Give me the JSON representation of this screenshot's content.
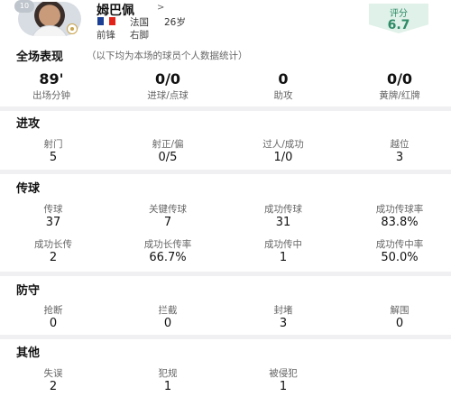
{
  "player": {
    "number_badge": "10",
    "name": "姆巴佩",
    "name_arrow": ">",
    "country": "法国",
    "age": "26岁",
    "position": "前锋",
    "foot": "右脚",
    "flag_colors": [
      "#1b3f95",
      "#ffffff",
      "#e2231a"
    ],
    "rating_label": "评分",
    "rating_value": "6.7",
    "rating_color": "#2e8a67"
  },
  "overview": {
    "title": "全场表现",
    "note": "（以下均为本场的球员个人数据统计）",
    "stats": [
      {
        "value": "89'",
        "label": "出场分钟"
      },
      {
        "value": "0/0",
        "label": "进球/点球"
      },
      {
        "value": "0",
        "label": "助攻"
      },
      {
        "value": "0/0",
        "label": "黄牌/红牌"
      }
    ]
  },
  "attack": {
    "title": "进攻",
    "stats": [
      {
        "label": "射门",
        "value": "5"
      },
      {
        "label": "射正/偏",
        "value": "0/5"
      },
      {
        "label": "过人/成功",
        "value": "1/0"
      },
      {
        "label": "越位",
        "value": "3"
      }
    ]
  },
  "passing": {
    "title": "传球",
    "row1": [
      {
        "label": "传球",
        "value": "37"
      },
      {
        "label": "关键传球",
        "value": "7"
      },
      {
        "label": "成功传球",
        "value": "31"
      },
      {
        "label": "成功传球率",
        "value": "83.8%"
      }
    ],
    "row2": [
      {
        "label": "成功长传",
        "value": "2"
      },
      {
        "label": "成功长传率",
        "value": "66.7%"
      },
      {
        "label": "成功传中",
        "value": "1"
      },
      {
        "label": "成功传中率",
        "value": "50.0%"
      }
    ]
  },
  "defense": {
    "title": "防守",
    "stats": [
      {
        "label": "抢断",
        "value": "0"
      },
      {
        "label": "拦截",
        "value": "0"
      },
      {
        "label": "封堵",
        "value": "3"
      },
      {
        "label": "解围",
        "value": "0"
      }
    ]
  },
  "other": {
    "title": "其他",
    "stats": [
      {
        "label": "失误",
        "value": "2"
      },
      {
        "label": "犯规",
        "value": "1"
      },
      {
        "label": "被侵犯",
        "value": "1"
      }
    ]
  }
}
